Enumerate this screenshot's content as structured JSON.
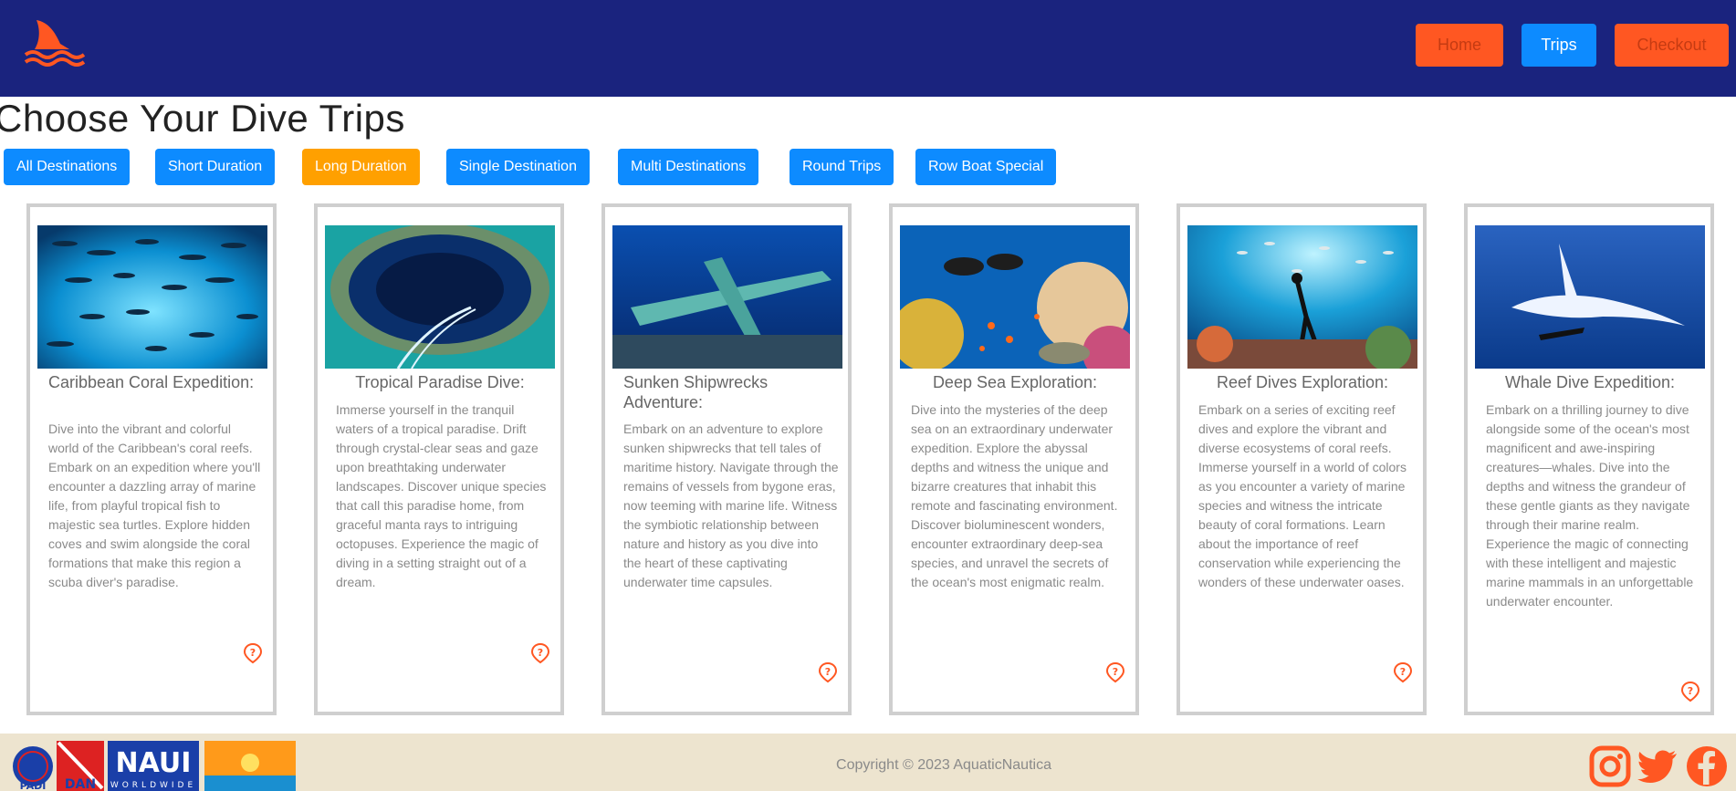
{
  "header": {
    "nav": {
      "home": "Home",
      "trips": "Trips",
      "checkout": "Checkout"
    },
    "logo_icon": "shark-fin-waves-icon"
  },
  "page_title": "Choose Your Dive Trips",
  "filters": [
    "All Destinations",
    "Short Duration",
    "Long Duration",
    "Single Destination",
    "Multi Destinations",
    "Round Trips",
    "Row Boat Special"
  ],
  "active_filter": "Long Duration",
  "cards": [
    {
      "title": "Caribbean Coral Expedition:",
      "desc": "Dive into the vibrant and colorful world of the Caribbean's coral reefs. Embark on an expedition where you'll encounter a dazzling array of marine life, from playful tropical fish to majestic sea turtles. Explore hidden coves and swim alongside the coral formations that make this region a scuba diver's paradise."
    },
    {
      "title": "Tropical Paradise Dive:",
      "desc": "Immerse yourself in the tranquil waters of a tropical paradise. Drift through crystal-clear seas and gaze upon breathtaking underwater landscapes. Discover unique species that call this paradise home, from graceful manta rays to intriguing octopuses. Experience the magic of diving in a setting straight out of a dream."
    },
    {
      "title": "Sunken Shipwrecks Adventure:",
      "desc": "Embark on an adventure to explore sunken shipwrecks that tell tales of maritime history. Navigate through the remains of vessels from bygone eras, now teeming with marine life. Witness the symbiotic relationship between nature and history as you dive into the heart of these captivating underwater time capsules."
    },
    {
      "title": "Deep Sea Exploration:",
      "desc": "Dive into the mysteries of the deep sea on an extraordinary underwater expedition. Explore the abyssal depths and witness the unique and bizarre creatures that inhabit this remote and fascinating environment. Discover bioluminescent wonders, encounter extraordinary deep-sea species, and unravel the secrets of the ocean's most enigmatic realm."
    },
    {
      "title": "Reef Dives Exploration:",
      "desc": "Embark on a series of exciting reef dives and explore the vibrant and diverse ecosystems of coral reefs. Immerse yourself in a world of colors as you encounter a variety of marine species and witness the intricate beauty of coral formations. Learn about the importance of reef conservation while experiencing the wonders of these underwater oases."
    },
    {
      "title": "Whale Dive Expedition:",
      "desc": "Embark on a thrilling journey to dive alongside some of the ocean's most magnificent and awe-inspiring creatures—whales. Dive into the depths and witness the grandeur of these gentle giants as they navigate through their marine realm. Experience the magic of connecting with these intelligent and majestic marine mammals in an unforgettable underwater encounter."
    }
  ],
  "footer": {
    "copyright": "Copyright © 2023 AquaticNautica",
    "partner_logo_text": {
      "padi": "PADI",
      "dan": "DAN",
      "naui": "NAUI",
      "naui_sub": "WORLDWIDE"
    },
    "social": [
      "instagram-icon",
      "twitter-icon",
      "facebook-icon"
    ]
  },
  "colors": {
    "header_bg": "#1a237e",
    "primary_button": "#0d8bff",
    "accent_orange": "#ff5722",
    "active_filter": "#ffa000",
    "footer_bg": "#ede4cf"
  }
}
